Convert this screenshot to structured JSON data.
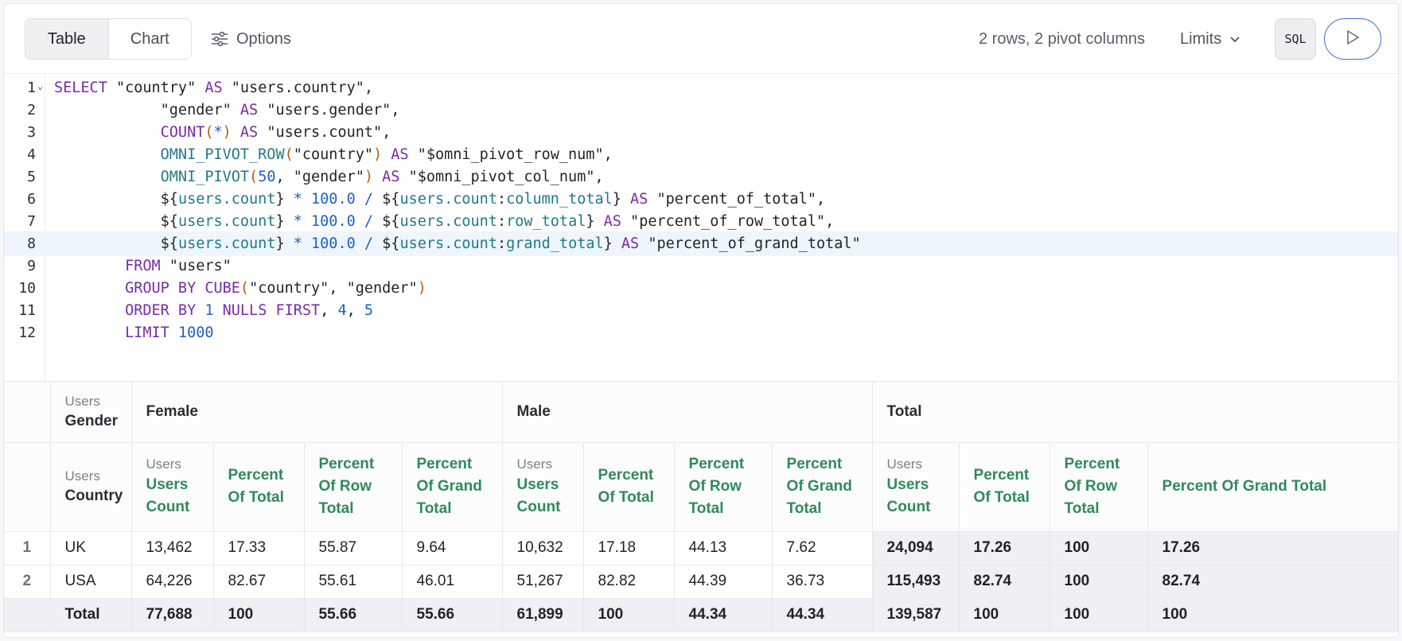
{
  "toolbar": {
    "tab_table": "Table",
    "tab_chart": "Chart",
    "options_label": "Options",
    "row_summary": "2 rows, 2 pivot columns",
    "limits_label": "Limits",
    "sql_label": "SQL"
  },
  "editor": {
    "line_numbers": [
      "1",
      "2",
      "3",
      "4",
      "5",
      "6",
      "7",
      "8",
      "9",
      "10",
      "11",
      "12"
    ],
    "active_line": 8
  },
  "table": {
    "corner_top_muted": "Users",
    "corner_top_label": "Gender",
    "corner_bottom_muted": "Users",
    "corner_bottom_label": "Country",
    "pivot_groups": [
      "Female",
      "Male",
      "Total"
    ],
    "measure_muted": "Users",
    "measures": [
      "Users Count",
      "Percent Of Total",
      "Percent Of Row Total",
      "Percent Of Grand Total"
    ],
    "rows": [
      {
        "idx": "1",
        "country": "UK",
        "cells": [
          "13,462",
          "17.33",
          "55.87",
          "9.64",
          "10,632",
          "17.18",
          "44.13",
          "7.62",
          "24,094",
          "17.26",
          "100",
          "17.26"
        ]
      },
      {
        "idx": "2",
        "country": "USA",
        "cells": [
          "64,226",
          "82.67",
          "55.61",
          "46.01",
          "51,267",
          "82.82",
          "44.39",
          "36.73",
          "115,493",
          "82.74",
          "100",
          "82.74"
        ]
      }
    ],
    "total_row": {
      "label": "Total",
      "cells": [
        "77,688",
        "100",
        "55.66",
        "55.66",
        "61,899",
        "100",
        "44.34",
        "44.34",
        "139,587",
        "100",
        "100",
        "100"
      ]
    }
  },
  "colors": {
    "accent_blue": "#3a6fd8",
    "measure_green": "#2f8a5b",
    "keyword_purple": "#7a2aa8"
  }
}
